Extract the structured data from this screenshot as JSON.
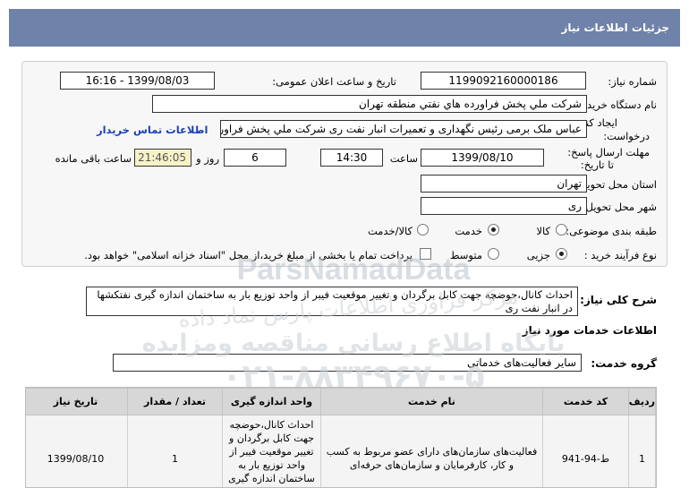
{
  "header": {
    "title": "جزئیات اطلاعات نیاز"
  },
  "form": {
    "need_number_label": "شماره نیاز:",
    "need_number": "1199092160000186",
    "announce_date_label": "تاریخ و ساعت اعلان عمومی:",
    "announce_date": "1399/08/03 - 16:16",
    "buyer_org_label": "نام دستگاه خریدار:",
    "buyer_org": "شرکت ملي پخش فراورده هاي نفتي منطقه تهران",
    "creator_label_1": "ایجاد کننده",
    "creator_label_2": "درخواست:",
    "creator": "عباس ملک برمی رئیس نگهداری و تعمیرات انبار نفت ری شرکت ملي پخش فراوردها",
    "contact_link": "اطلاعات تماس خریدار",
    "deadline_label_1": "مهلت ارسال پاسخ:",
    "deadline_label_2": "تا تاریخ:",
    "deadline_date": "1399/08/10",
    "time_label": "ساعت",
    "deadline_time": "14:30",
    "days_value": "6",
    "days_label": "روز و",
    "remaining_time": "21:46:05",
    "remaining_label": "ساعت باقی مانده",
    "province_label": "استان محل تحویل:",
    "province": "تهران",
    "city_label": "شهر محل تحویل:",
    "city": "ری",
    "category_label": "طبقه بندی موضوعی:",
    "category_options": [
      "کالا",
      "خدمت",
      "کالا/خدمت"
    ],
    "category_selected": "خدمت",
    "process_label": "نوع فرآیند خرید :",
    "process_options": [
      "جزیی",
      "متوسط"
    ],
    "process_selected": "جزیی",
    "payment_note": "پرداخت تمام یا بخشی از مبلغ خرید،از محل \"اسناد خزانه اسلامی\" خواهد بود."
  },
  "summary": {
    "label": "شرح کلی نیاز:",
    "text": "احداث کانال،حوضچه جهت کابل برگردان و تغییر موقعیت فیبر از واحد توزیع بار به ساختمان اندازه گیری نفتکشها در انبار نفت ری"
  },
  "services_section": {
    "title": "اطلاعات خدمات مورد نیاز"
  },
  "service_group": {
    "label": "گروه خدمت:",
    "value": "سایر فعالیت‌های خدماتی"
  },
  "table": {
    "headers": [
      "ردیف",
      "کد خدمت",
      "نام خدمت",
      "واحد اندازه گیری",
      "تعداد / مقدار",
      "تاریخ نیاز"
    ],
    "rows": [
      {
        "row": "1",
        "code": "ط-94-941",
        "name": "فعالیت‌های سازمان‌های دارای عضو مربوط به کسب و کار، کارفرمایان و سازمان‌های حرفه‌ای",
        "unit": "احداث کانال،حوضچه جهت کابل برگردان و تغییر موقعیت فیبر از واحد توزیع بار به ساختمان اندازه گیری نفتکش",
        "qty": "1",
        "date": "1399/08/10"
      }
    ]
  },
  "watermark": {
    "line1": "ParsNamadData",
    "line2": "مرکز فراوری اطلاعات پارس نماد داده",
    "line3": "پایگاه اطلاع رسانی مناقصه ومزایده",
    "line4": "۰۲۱-۸۸۳۴۹۶۷۰-۵"
  },
  "colors": {
    "titlebar": "#6f82a9",
    "panel": "#f7f7f7",
    "link": "#1a3fb8",
    "remaining_bg": "#f8f2c8"
  }
}
